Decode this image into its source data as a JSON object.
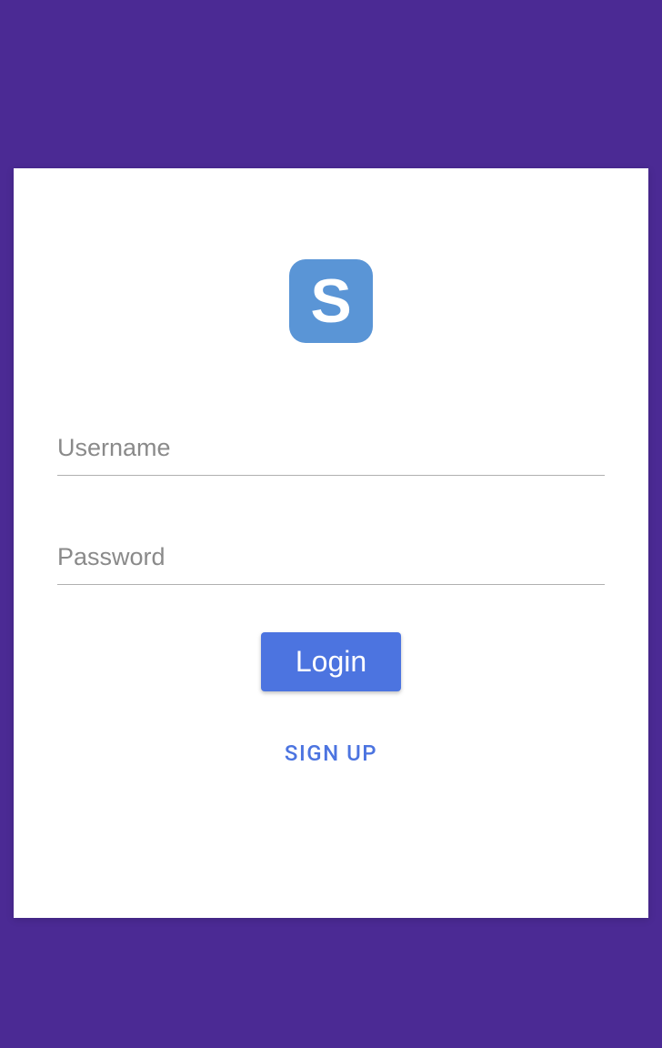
{
  "logo": {
    "letter": "S"
  },
  "form": {
    "username_placeholder": "Username",
    "password_placeholder": "Password",
    "login_label": "Login",
    "signup_label": "SIGN UP"
  },
  "colors": {
    "background": "#4b2a94",
    "card": "#ffffff",
    "logo_bg": "#5a95d6",
    "primary": "#4c74e0"
  }
}
